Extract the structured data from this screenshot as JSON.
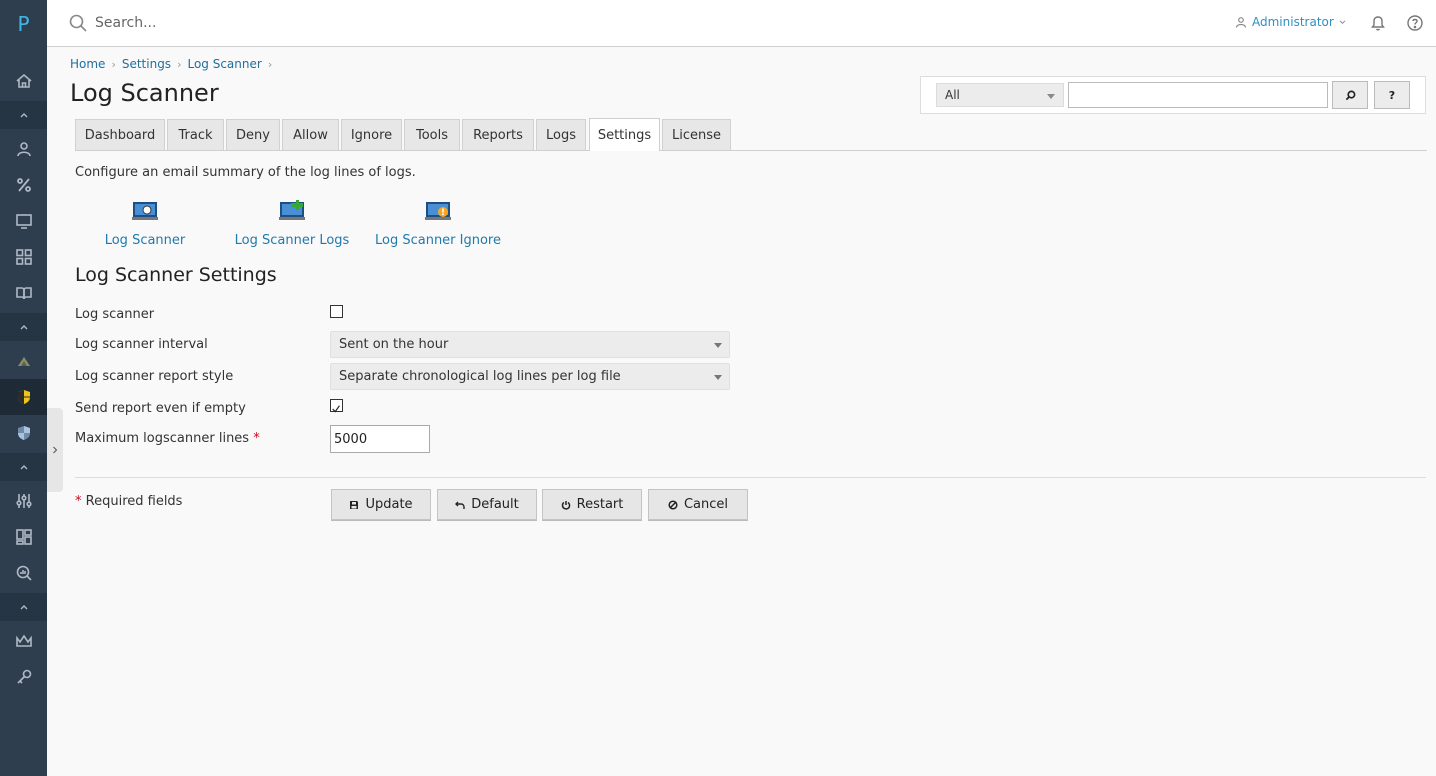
{
  "app": {
    "logo_letter": "P"
  },
  "header": {
    "search_placeholder": "Search...",
    "user_label": "Administrator"
  },
  "breadcrumb": [
    "Home",
    "Settings",
    "Log Scanner"
  ],
  "page_title": "Log Scanner",
  "search_box": {
    "scope_selected": "All",
    "search_button_icon": "magnifier-icon",
    "help_button_label": "?"
  },
  "tabs": [
    "Dashboard",
    "Track",
    "Deny",
    "Allow",
    "Ignore",
    "Tools",
    "Reports",
    "Logs",
    "Settings",
    "License"
  ],
  "active_tab": "Settings",
  "description": "Configure an email summary of the log lines of logs.",
  "quick_links": [
    {
      "label": "Log Scanner",
      "icon": "monitor-magnifier-icon"
    },
    {
      "label": "Log Scanner Logs",
      "icon": "monitor-plus-icon"
    },
    {
      "label": "Log Scanner Ignore",
      "icon": "monitor-warning-icon"
    }
  ],
  "section_title": "Log Scanner Settings",
  "form": {
    "log_scanner": {
      "label": "Log scanner",
      "checked": false
    },
    "interval": {
      "label": "Log scanner interval",
      "value": "Sent on the hour"
    },
    "report_style": {
      "label": "Log scanner report style",
      "value": "Separate chronological log lines per log file"
    },
    "send_empty": {
      "label": "Send report even if empty",
      "checked": true
    },
    "max_lines": {
      "label": "Maximum logscanner lines",
      "value": "5000",
      "required_marker": "*"
    }
  },
  "required_note": {
    "marker": "*",
    "text": "Required fields"
  },
  "buttons": {
    "update": "Update",
    "default": "Default",
    "restart": "Restart",
    "cancel": "Cancel"
  },
  "colors": {
    "sidebar_bg": "#2f3e4e",
    "link": "#1f7aad",
    "accent": "#41b6e6",
    "required": "#d0021b"
  }
}
